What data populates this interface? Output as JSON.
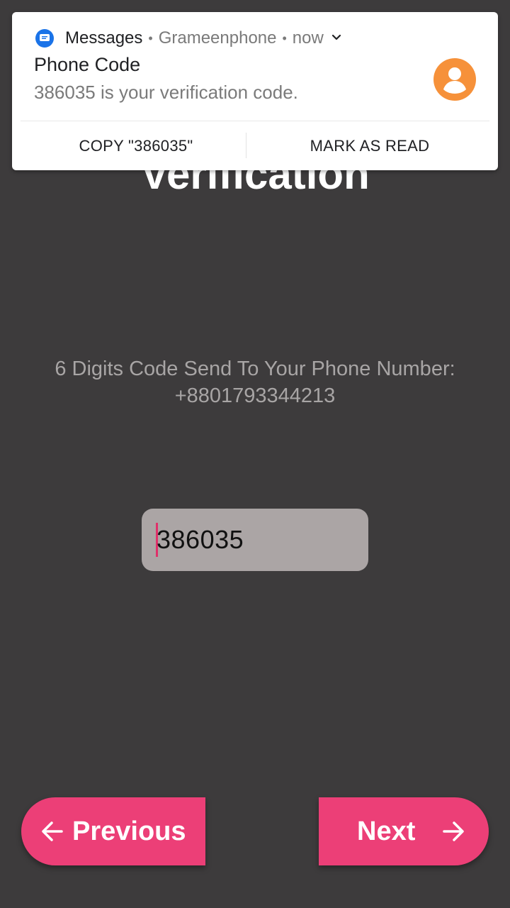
{
  "page": {
    "title": "Verification",
    "instruction_line1": "6 Digits Code Send To Your Phone Number:",
    "phone_number": "+8801793344213",
    "code_value": "386035"
  },
  "nav": {
    "previous_label": "Previous",
    "next_label": "Next",
    "previous_icon": "arrow-left-icon",
    "next_icon": "arrow-right-icon"
  },
  "notification": {
    "app_name": "Messages",
    "sender": "Grameenphone",
    "time": "now",
    "title": "Phone Code",
    "text": "386035 is your verification code.",
    "actions": {
      "copy": "COPY \"386035\"",
      "mark_read": "MARK AS READ"
    },
    "app_icon": "messages-icon",
    "avatar_icon": "person-icon"
  },
  "colors": {
    "background": "#3d3b3c",
    "accent": "#ec3f77",
    "input_bg": "#aba5a5",
    "avatar": "#f6913a",
    "messages_blue": "#1a73e8"
  }
}
